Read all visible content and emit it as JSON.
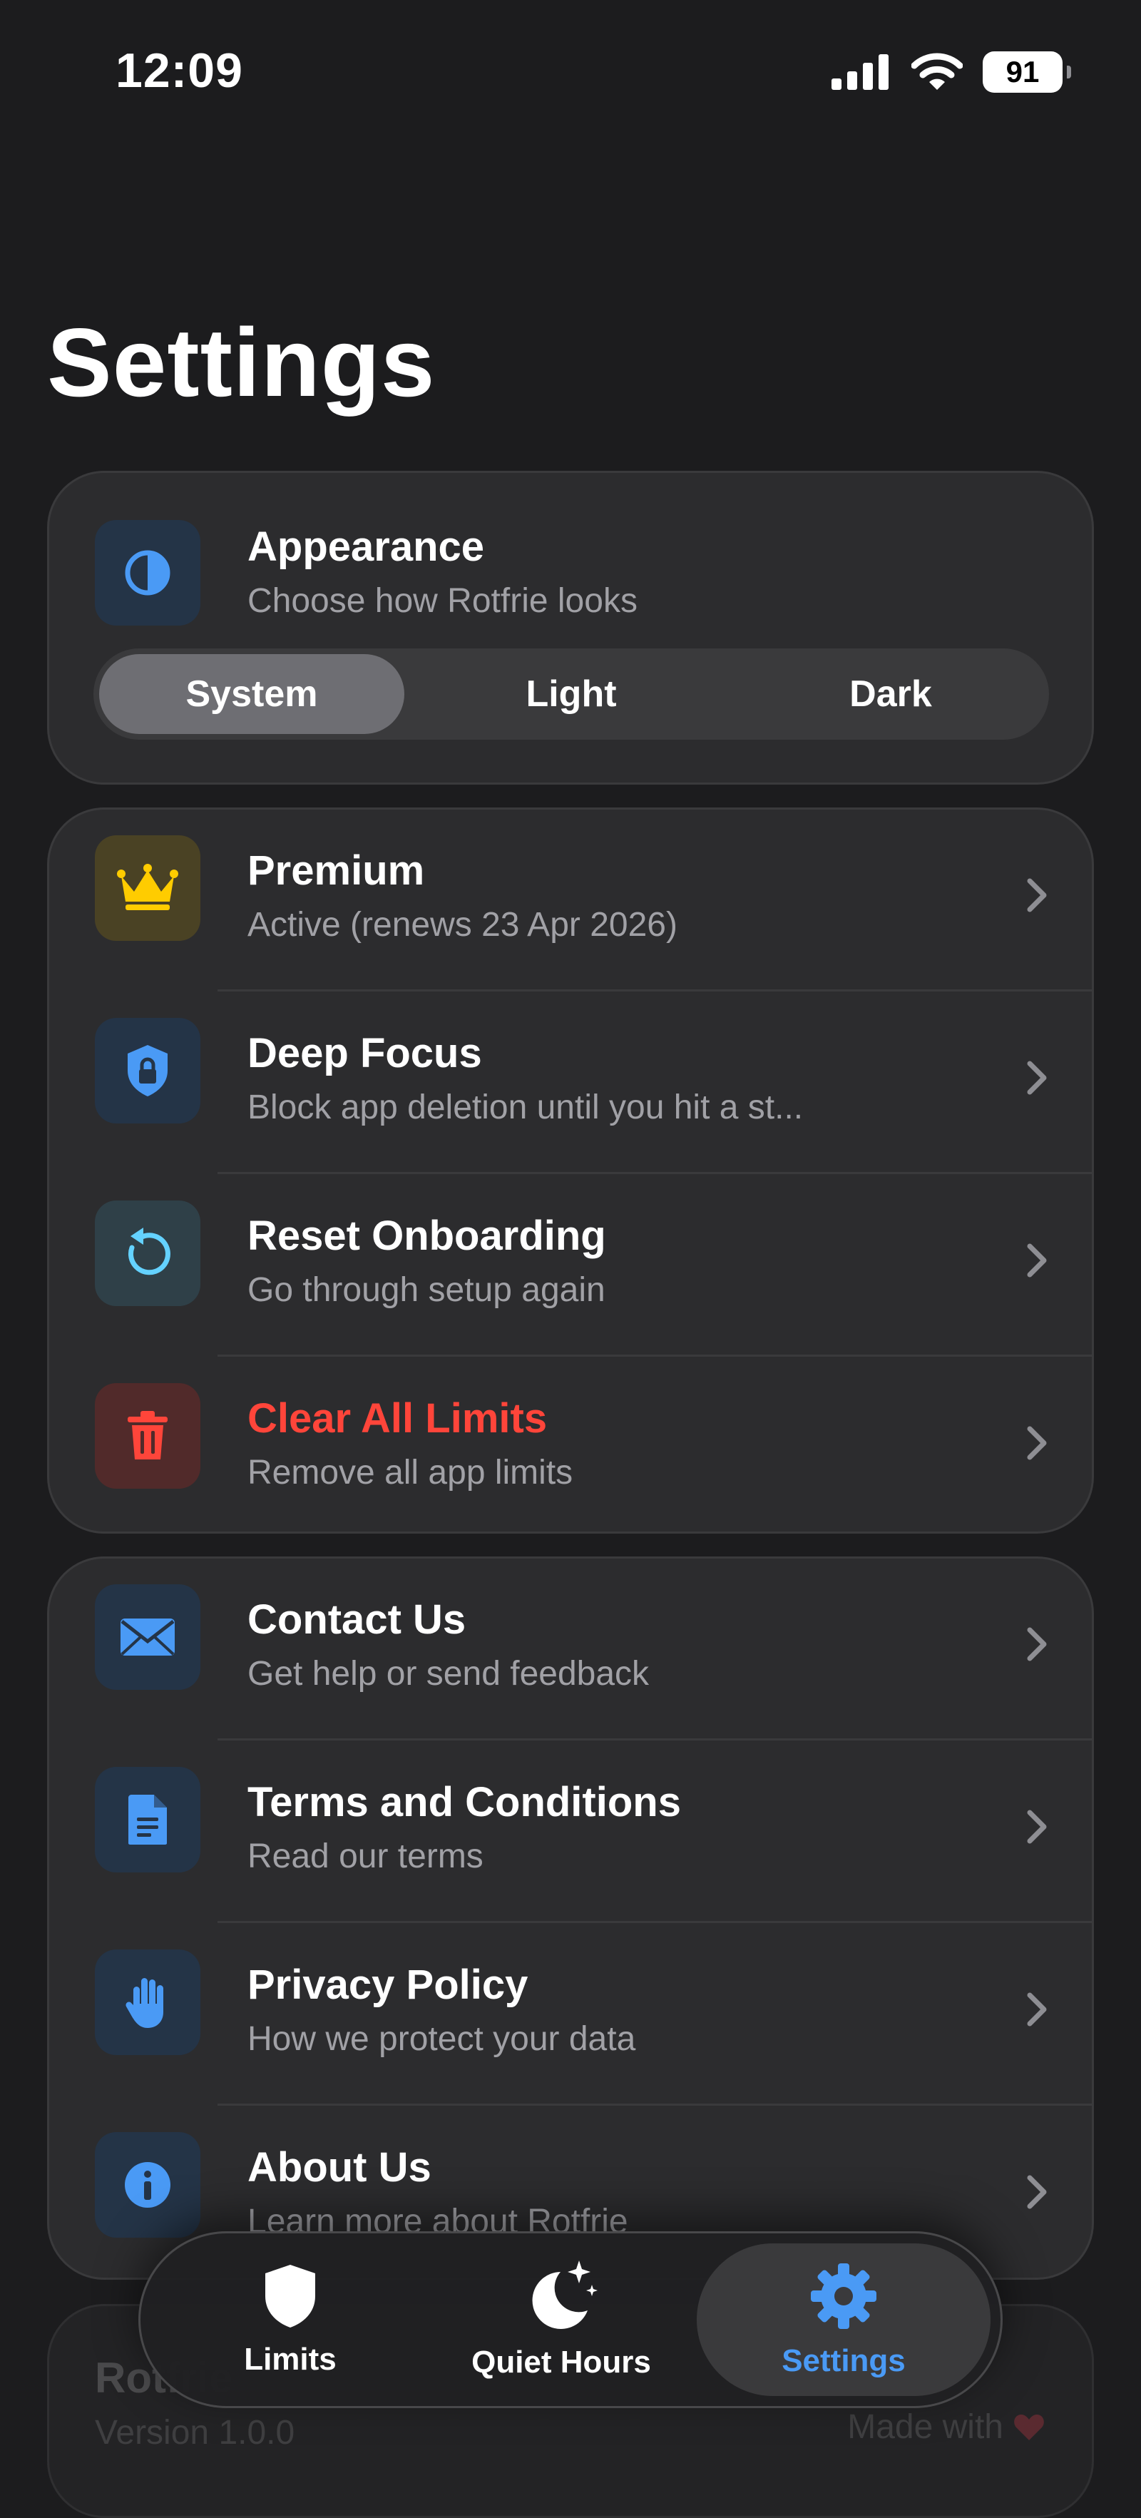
{
  "status_bar": {
    "time": "12:09",
    "battery": "91"
  },
  "page_title": "Settings",
  "appearance": {
    "title": "Appearance",
    "subtitle": "Choose how Rotfrie looks",
    "options": [
      "System",
      "Light",
      "Dark"
    ],
    "selected": "System"
  },
  "account_items": [
    {
      "icon": "crown-icon",
      "title": "Premium",
      "subtitle": "Active (renews 23 Apr 2026)",
      "color": "#ffcc00"
    },
    {
      "icon": "shield-lock-icon",
      "title": "Deep Focus",
      "subtitle": "Block app deletion until you hit a st...",
      "color": "#4a9af5"
    },
    {
      "icon": "reset-icon",
      "title": "Reset Onboarding",
      "subtitle": "Go through setup again",
      "color": "#64d2ff"
    },
    {
      "icon": "trash-icon",
      "title": "Clear All Limits",
      "subtitle": "Remove all app limits",
      "color": "#ff453a"
    }
  ],
  "info_items": [
    {
      "icon": "envelope-icon",
      "title": "Contact Us",
      "subtitle": "Get help or send feedback"
    },
    {
      "icon": "document-icon",
      "title": "Terms and Conditions",
      "subtitle": "Read our terms"
    },
    {
      "icon": "hand-icon",
      "title": "Privacy Policy",
      "subtitle": "How we protect your data"
    },
    {
      "icon": "info-icon",
      "title": "About Us",
      "subtitle": "Learn more about Rotfrie"
    }
  ],
  "footer": {
    "app_name": "Rotfrie",
    "version": "Version 1.0.0",
    "made_with": "Made with"
  },
  "tabs": [
    {
      "label": "Limits",
      "icon": "shield-icon"
    },
    {
      "label": "Quiet Hours",
      "icon": "moon-stars-icon"
    },
    {
      "label": "Settings",
      "icon": "gear-icon",
      "active": true
    }
  ],
  "colors": {
    "accent": "#4a9af5",
    "destructive": "#ff453a",
    "premium": "#ffcc00"
  }
}
